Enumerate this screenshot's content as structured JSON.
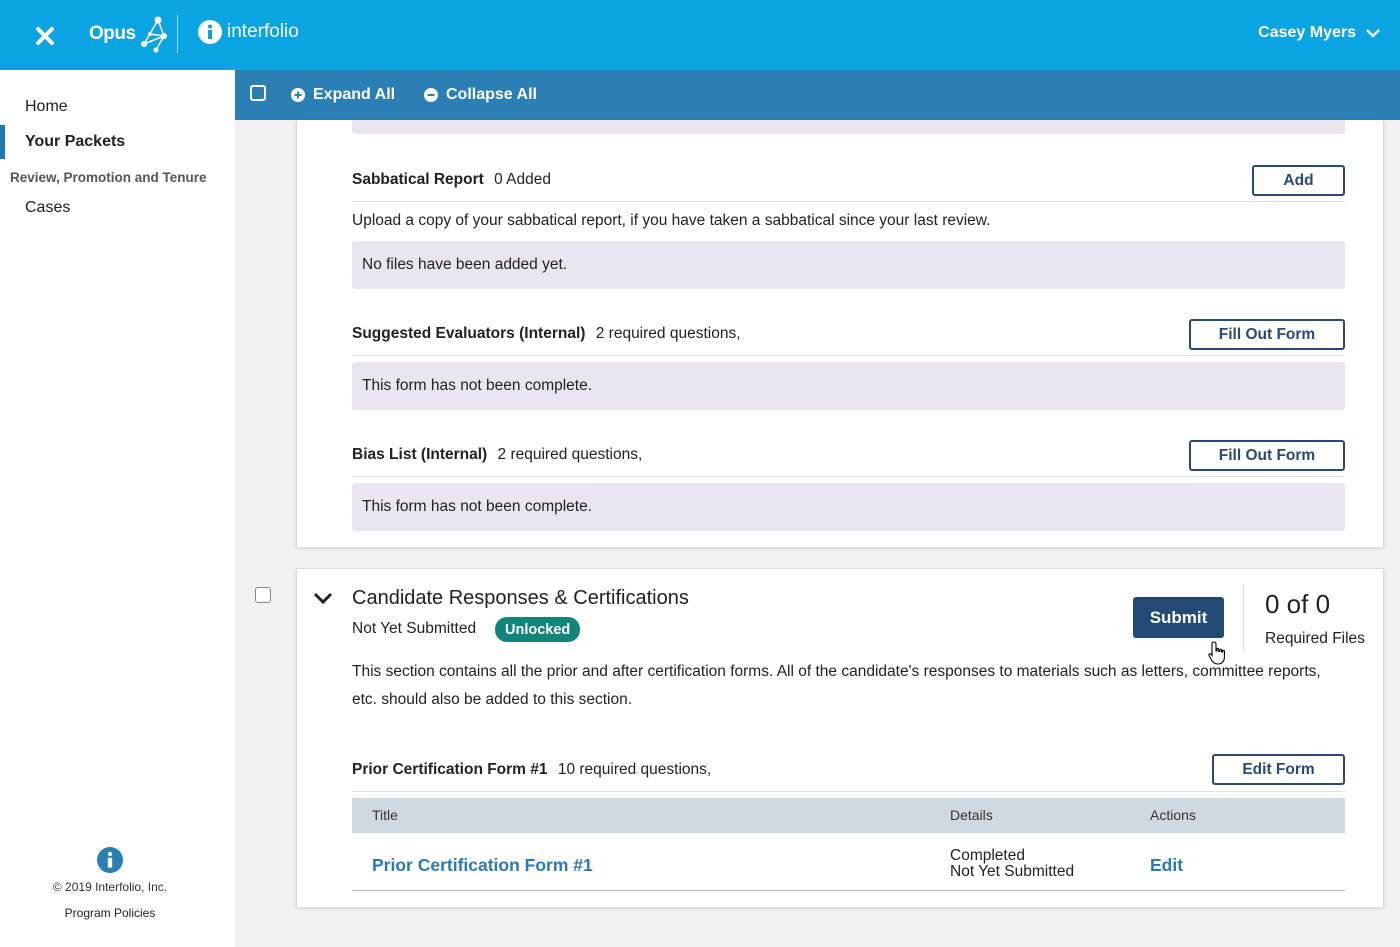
{
  "header": {
    "app_name": "Opus",
    "brand": "interfolio",
    "user_name": "Casey Myers"
  },
  "sidebar": {
    "items": [
      {
        "label": "Home"
      },
      {
        "label": "Your Packets"
      }
    ],
    "section_heading": "Review, Promotion and Tenure",
    "section_items": [
      {
        "label": "Cases"
      }
    ],
    "copyright": "© 2019 Interfolio, Inc.",
    "policies_label": "Program Policies"
  },
  "toolbar": {
    "expand_label": "Expand All",
    "collapse_label": "Collapse All"
  },
  "packet_items": {
    "sabbatical": {
      "title": "Sabbatical Report",
      "meta": "0 Added",
      "button": "Add",
      "description": "Upload a copy of your sabbatical report, if you have taken a sabbatical since your last review.",
      "empty": "No files have been added yet."
    },
    "evaluators": {
      "title": "Suggested Evaluators (Internal)",
      "meta": "2 required questions,",
      "button": "Fill Out Form",
      "empty": "This form has not been complete."
    },
    "bias": {
      "title": "Bias List (Internal)",
      "meta": "2 required questions,",
      "button": "Fill Out Form",
      "empty": "This form has not been complete."
    }
  },
  "section": {
    "title": "Candidate Responses & Certifications",
    "status": "Not Yet Submitted",
    "badge": "Unlocked",
    "submit_label": "Submit",
    "count": "0 of 0",
    "count_label": "Required Files",
    "description": "This section contains all the prior and after certification forms. All of the candidate's responses to materials such as letters, committee reports, etc. should also be added to this section.",
    "form": {
      "title": "Prior Certification Form #1",
      "meta": "10 required questions,",
      "button": "Edit Form",
      "table_headers": [
        "Title",
        "Details",
        "Actions"
      ],
      "rows": [
        {
          "title": "Prior Certification Form #1",
          "detail_line1": "Completed",
          "detail_line2": "Not Yet Submitted",
          "action": "Edit"
        }
      ]
    }
  },
  "colors": {
    "header_bg": "#0ba4e2",
    "toolbar_bg": "#2a80b5",
    "primary_button": "#234a75",
    "badge_bg": "#11857a",
    "link": "#2a7ab5",
    "grey_box": "#e9e6ef"
  },
  "icons": {
    "close": "close-icon",
    "opus_logo": "opus-constellation-icon",
    "interfolio_logo": "info-circle-icon",
    "user_menu": "chevron-down-icon",
    "expand": "plus-circle-icon",
    "collapse": "minus-circle-icon",
    "section_toggle": "chevron-down-icon",
    "cursor": "hand-pointer-icon"
  }
}
